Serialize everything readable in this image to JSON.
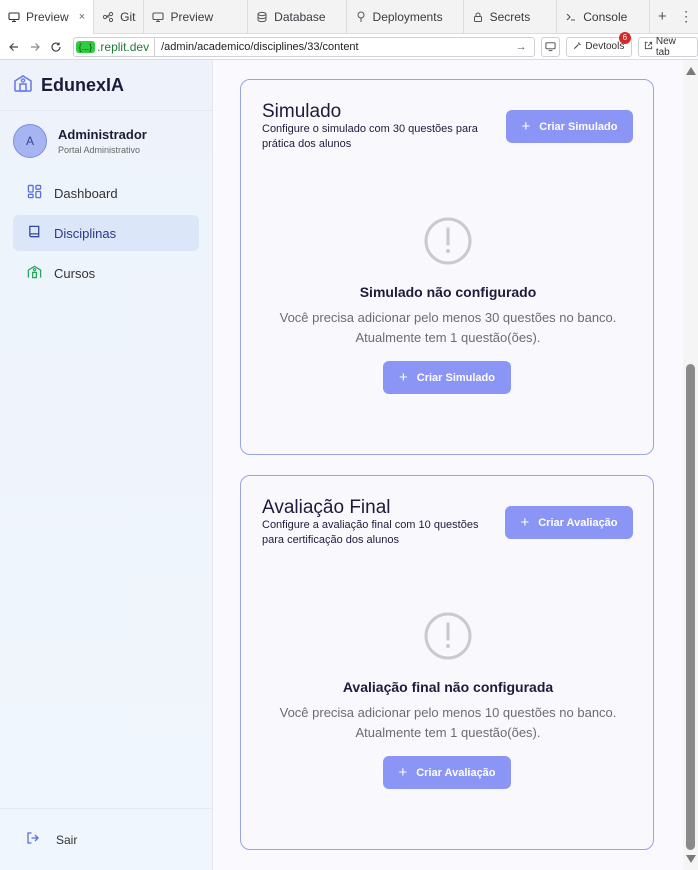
{
  "browser": {
    "tabs": [
      {
        "label": "Preview",
        "icon": "monitor-icon",
        "active": true
      },
      {
        "label": "Git",
        "icon": "git-icon"
      },
      {
        "label": "Preview",
        "icon": "monitor-icon"
      },
      {
        "label": "Database",
        "icon": "database-icon"
      },
      {
        "label": "Deployments",
        "icon": "deploy-icon"
      },
      {
        "label": "Secrets",
        "icon": "lock-icon"
      },
      {
        "label": "Console",
        "icon": "terminal-icon"
      }
    ],
    "close_glyph": "×",
    "new_tab_glyph": "+",
    "more_glyph": "⋮",
    "domain_badge": "{...}",
    "domain": ".replit.dev",
    "path": "/admin/academico/disciplines/33/content",
    "devtools_label": "Devtools",
    "devtools_count": "6",
    "new_tab_label": "New tab"
  },
  "sidebar": {
    "brand": "EdunexIA",
    "user": {
      "initial": "A",
      "name": "Administrador",
      "role": "Portal Administrativo"
    },
    "items": [
      {
        "label": "Dashboard",
        "icon": "dashboard-icon"
      },
      {
        "label": "Disciplinas",
        "icon": "book-icon",
        "active": true
      },
      {
        "label": "Cursos",
        "icon": "school-icon"
      }
    ],
    "logout": "Sair"
  },
  "main": {
    "simulado": {
      "title": "Simulado",
      "description": "Configure o simulado com 30 questões para prática dos alunos",
      "header_button": "Criar Simulado",
      "empty_title": "Simulado não configurado",
      "empty_line1": "Você precisa adicionar pelo menos 30 questões no banco.",
      "empty_line2": "Atualmente tem 1 questão(ões).",
      "empty_button": "Criar Simulado"
    },
    "avaliacao": {
      "title": "Avaliação Final",
      "description": "Configure a avaliação final com 10 questões para certificação dos alunos",
      "header_button": "Criar Avaliação",
      "empty_title": "Avaliação final não configurada",
      "empty_line1": "Você precisa adicionar pelo menos 10 questões no banco.",
      "empty_line2": "Atualmente tem 1 questão(ões).",
      "empty_button": "Criar Avaliação"
    }
  },
  "colors": {
    "accent": "#8a95f5",
    "card_border": "#9aa4e4",
    "sidebar_bg": "#eef3fb",
    "active_item": "#dbe6f8"
  }
}
